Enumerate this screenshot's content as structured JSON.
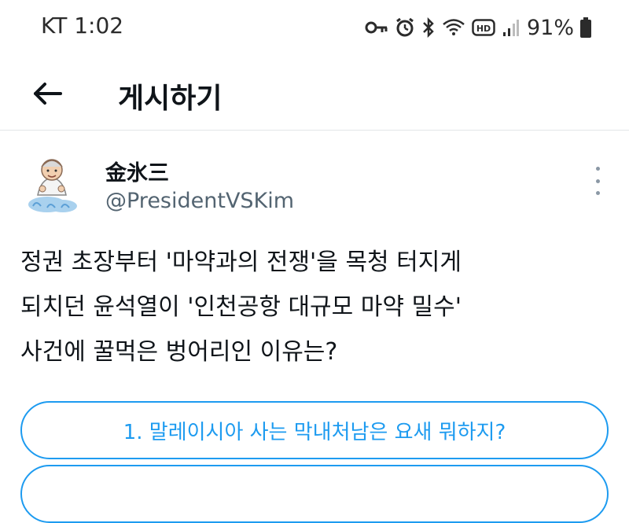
{
  "status_bar": {
    "carrier_time": "KT 1:02",
    "battery": "91%",
    "icons": [
      "key-icon",
      "alarm-icon",
      "bluetooth-icon",
      "wifi-icon",
      "hd-icon",
      "signal-icon",
      "battery-icon"
    ]
  },
  "header": {
    "title": "게시하기",
    "back_icon": "arrow-left-icon"
  },
  "post": {
    "author_name": "金氷三",
    "handle": "@PresidentVSKim",
    "text_lines": [
      "정권 초장부터 '마약과의 전쟁'을 목청 터지게",
      "되치던 윤석열이 '인천공항 대규모 마약 밀수'",
      "사건에 꿀먹은 벙어리인 이유는?"
    ],
    "poll_options": [
      "1. 말레이시아 사는 막내처남은 요새 뭐하지?"
    ]
  },
  "colors": {
    "accent": "#1d9bf0",
    "text": "#0f1419",
    "secondary": "#536471"
  }
}
